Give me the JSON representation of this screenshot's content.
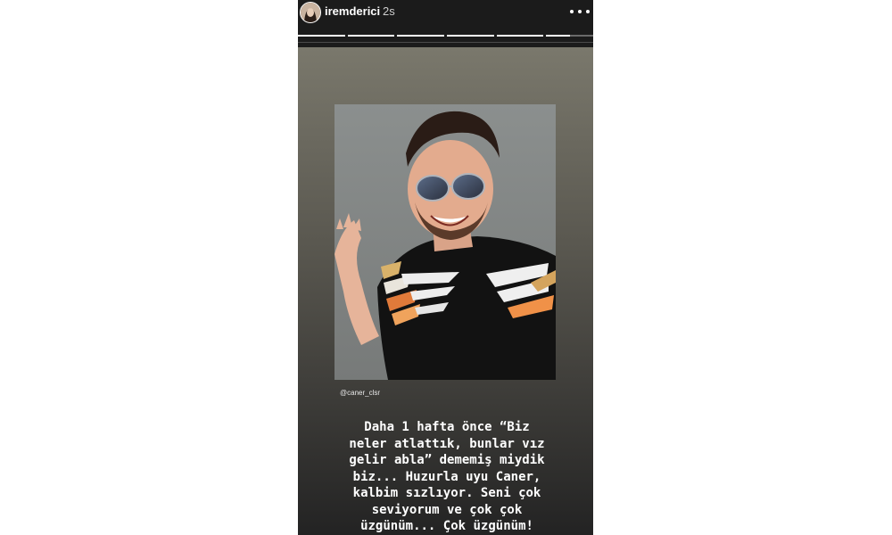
{
  "story": {
    "username": "iremderici",
    "time_ago": "2s",
    "progress_segments": [
      1,
      1,
      1,
      1,
      1,
      0.5
    ],
    "photo_credit": "@caner_clsr",
    "caption_lines": [
      "Daha 1 hafta önce “Biz",
      "neler atlattık, bunlar vız",
      "gelir abla” dememiş miydik",
      "biz... Huzurla uyu Caner,",
      "kalbim sızlıyor. Seni çok",
      "seviyorum ve çok çok",
      "üzgünüm... Çok üzgünüm!"
    ]
  },
  "icons": {
    "more": "more-horizontal-icon",
    "avatar": "profile-avatar"
  },
  "colors": {
    "topbar": "#1b1b1b",
    "text": "#ffffff",
    "background_top": "#7a786c",
    "background_bottom": "#232323"
  }
}
